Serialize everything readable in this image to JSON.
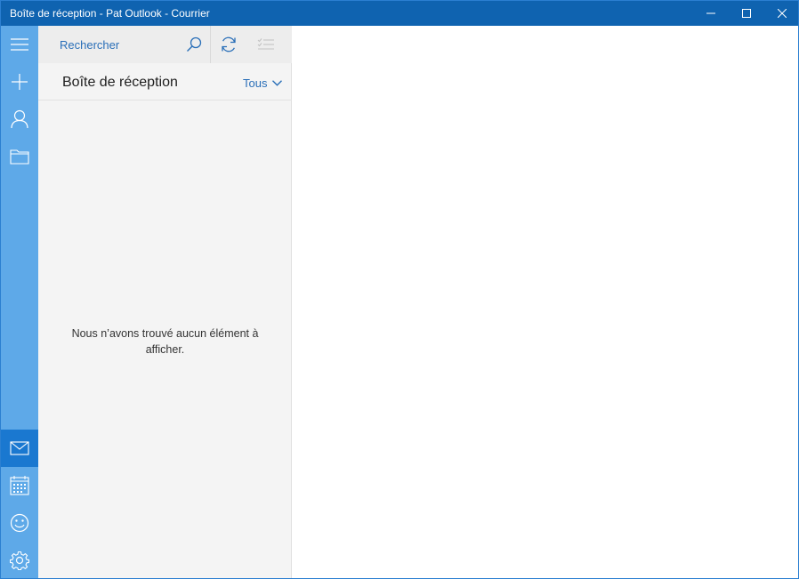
{
  "window": {
    "title": "Boîte de réception - Pat Outlook - Courrier",
    "controls": {
      "minimize": "minimize-icon",
      "maximize": "maximize-icon",
      "close": "close-icon"
    }
  },
  "rail": {
    "top": [
      "hamburger-menu-icon",
      "new-mail-icon",
      "account-icon",
      "folders-icon"
    ],
    "bottom": [
      "mail-icon",
      "calendar-icon",
      "feedback-smiley-icon",
      "settings-gear-icon"
    ],
    "active": "mail-icon"
  },
  "search": {
    "placeholder": "Rechercher",
    "icons": [
      "search-icon",
      "sync-icon",
      "selection-mode-icon"
    ]
  },
  "folder": {
    "title": "Boîte de réception",
    "filter_label": "Tous"
  },
  "empty_message": "Nous n’avons trouvé aucun élément à afficher.",
  "colors": {
    "titlebar": "#0f63b0",
    "rail": "#5ea9e8",
    "rail_active": "#1a78d0",
    "accent_text": "#2a6fb8",
    "pane_bg": "#f4f4f4"
  }
}
